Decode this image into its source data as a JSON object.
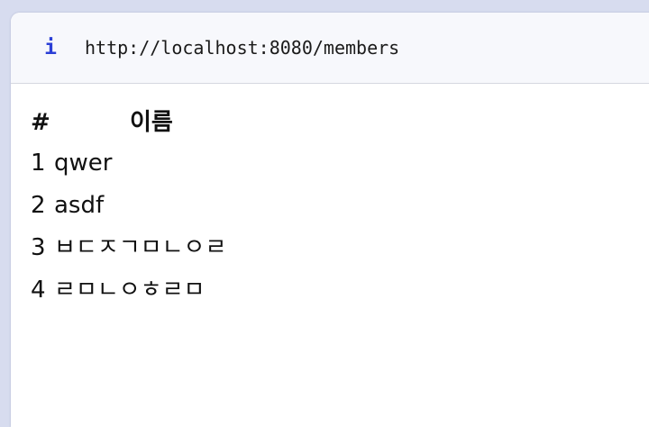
{
  "address_bar": {
    "info_icon": "i",
    "url": "http://localhost:8080/members"
  },
  "table": {
    "headers": [
      "#",
      "이름"
    ],
    "rows": [
      {
        "id": "1",
        "name": "qwer"
      },
      {
        "id": "2",
        "name": "asdf"
      },
      {
        "id": "3",
        "name": "ㅂㄷㅈㄱㅁㄴㅇㄹ"
      },
      {
        "id": "4",
        "name": "ㄹㅁㄴㅇㅎㄹㅁ"
      }
    ]
  }
}
